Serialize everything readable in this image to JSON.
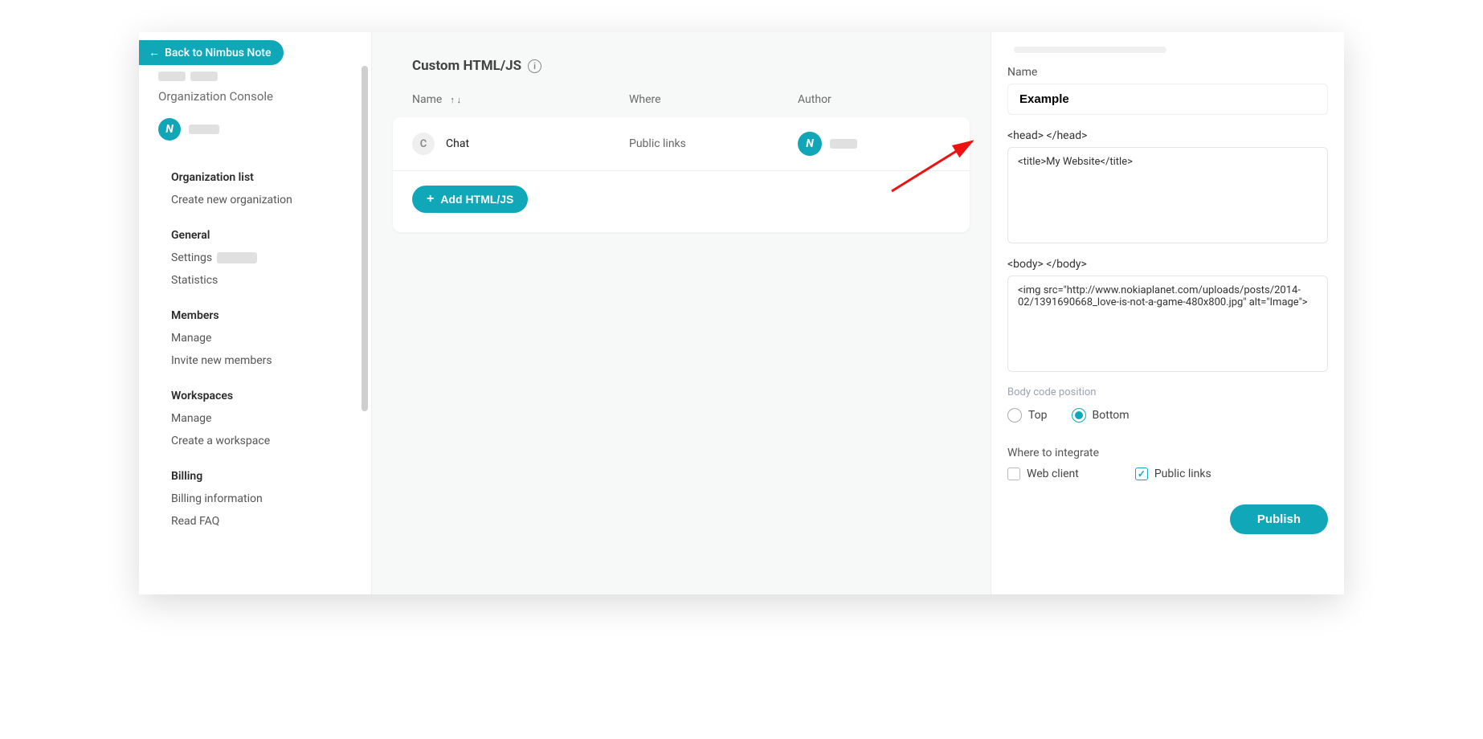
{
  "sidebar": {
    "back_label": "Back to Nimbus Note",
    "org_console": "Organization Console",
    "sections": [
      {
        "heading": "Organization list",
        "items": [
          "Create new organization"
        ]
      },
      {
        "heading": "General",
        "items": [
          "Settings",
          "Statistics"
        ]
      },
      {
        "heading": "Members",
        "items": [
          "Manage",
          "Invite new members"
        ]
      },
      {
        "heading": "Workspaces",
        "items": [
          "Manage",
          "Create a workspace"
        ]
      },
      {
        "heading": "Billing",
        "items": [
          "Billing information",
          "Read FAQ"
        ]
      }
    ]
  },
  "main": {
    "title": "Custom HTML/JS",
    "columns": {
      "name": "Name",
      "where": "Where",
      "author": "Author"
    },
    "rows": [
      {
        "badge": "C",
        "name": "Chat",
        "where": "Public links"
      }
    ],
    "add_label": "Add HTML/JS"
  },
  "drawer": {
    "name_label": "Name",
    "name_value": "Example",
    "head_label": "<head> </head>",
    "head_value": "<title>My Website</title>",
    "body_label": "<body> </body>",
    "body_value": "<img src=\"http://www.nokiaplanet.com/uploads/posts/2014-02/1391690668_love-is-not-a-game-480x800.jpg\" alt=\"Image\">",
    "body_pos_label": "Body code position",
    "radio_top": "Top",
    "radio_bottom": "Bottom",
    "radio_selected": "Bottom",
    "where_label": "Where to integrate",
    "check_web": "Web client",
    "check_public": "Public links",
    "public_checked": true,
    "web_checked": false,
    "publish_label": "Publish"
  }
}
